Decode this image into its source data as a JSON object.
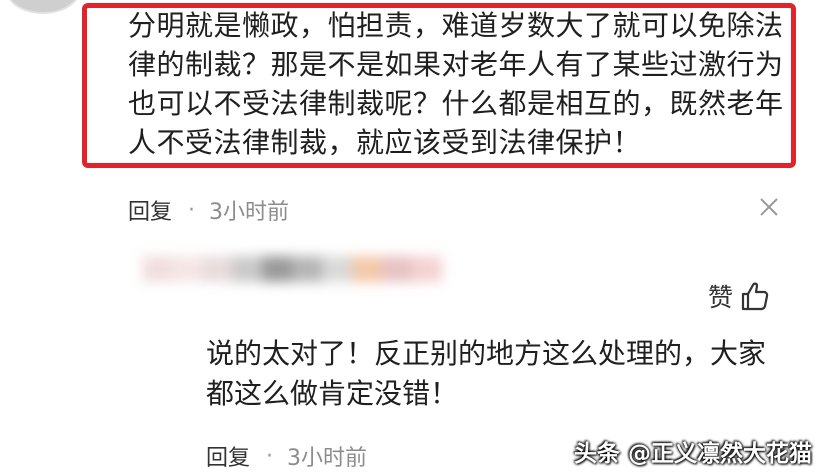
{
  "comment": {
    "lines": [
      "分明就是懒政，怕担责，难道岁数大了就可以免除法",
      "律的制裁？那是不是如果对老年人有了某些过激行为",
      "也可以不受法律制裁呢？什么都是相互的，既然老年",
      "人不受法律制裁，就应该受到法律保护！"
    ],
    "reply_label": "回复",
    "separator": "·",
    "time": "3小时前"
  },
  "reply": {
    "lines": [
      "说的太对了！反正别的地方这么处理的，大家",
      "都这么做肯定没错！"
    ],
    "like_label": "赞",
    "reply_label": "回复",
    "separator": "·",
    "time": "3小时前"
  },
  "watermark": "头条 @正义凛然大花猫",
  "colors": {
    "highlight_border": "#e0242b",
    "blurred_name": [
      "#f2dede",
      "#f5e6e6",
      "#e8dcdc",
      "#c9c9c9",
      "#9a9a9a",
      "#b5b5b5",
      "#d9d9d9",
      "#f3c9a8",
      "#e7c3c3",
      "#f4d2d2"
    ]
  }
}
